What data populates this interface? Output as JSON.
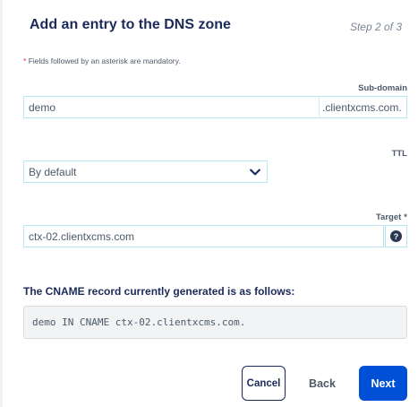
{
  "dialog": {
    "title": "Add an entry to the DNS zone",
    "step": "Step 2 of 3",
    "mandatory_note": "Fields followed by an asterisk are mandatory.",
    "mandatory_asterisk": "*"
  },
  "subdomain": {
    "label": "Sub-domain",
    "value": "demo",
    "suffix": ".clientxcms.com."
  },
  "ttl": {
    "label": "TTL",
    "selected": "By default",
    "icon": "chevron-down-icon"
  },
  "target": {
    "label": "Target",
    "asterisk": "*",
    "value": "ctx-02.clientxcms.com",
    "help_icon": "question-circle-icon",
    "help_glyph": "?"
  },
  "record": {
    "title": "The CNAME record currently generated is as follows:",
    "value": "demo IN CNAME ctx-02.clientxcms.com."
  },
  "actions": {
    "cancel_label": "Cancel",
    "back_label": "Back",
    "next_label": "Next"
  },
  "colors": {
    "title": "#1b2a59",
    "primary_button": "#0050d7",
    "input_border": "#b8e6f2",
    "asterisk": "#e0264a"
  }
}
